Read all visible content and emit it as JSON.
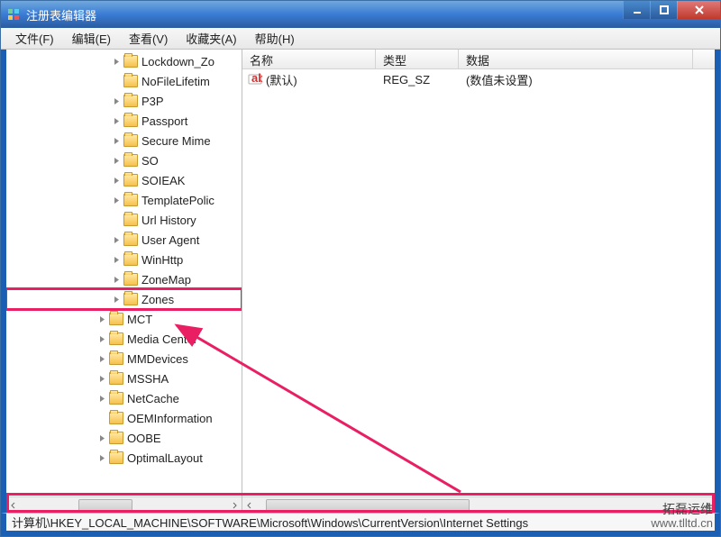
{
  "window": {
    "title": "注册表编辑器"
  },
  "menu": {
    "file": "文件(F)",
    "edit": "编辑(E)",
    "view": "查看(V)",
    "favorites": "收藏夹(A)",
    "help": "帮助(H)"
  },
  "tree": {
    "indent_base": 100,
    "items": [
      {
        "label": "Lockdown_Zo",
        "level": 1,
        "expandable": true
      },
      {
        "label": "NoFileLifetim",
        "level": 1,
        "expandable": false
      },
      {
        "label": "P3P",
        "level": 1,
        "expandable": true
      },
      {
        "label": "Passport",
        "level": 1,
        "expandable": true
      },
      {
        "label": "Secure Mime",
        "level": 1,
        "expandable": true
      },
      {
        "label": "SO",
        "level": 1,
        "expandable": true
      },
      {
        "label": "SOIEAK",
        "level": 1,
        "expandable": true
      },
      {
        "label": "TemplatePolic",
        "level": 1,
        "expandable": true
      },
      {
        "label": "Url History",
        "level": 1,
        "expandable": false
      },
      {
        "label": "User Agent",
        "level": 1,
        "expandable": true
      },
      {
        "label": "WinHttp",
        "level": 1,
        "expandable": true
      },
      {
        "label": "ZoneMap",
        "level": 1,
        "expandable": true
      },
      {
        "label": "Zones",
        "level": 1,
        "expandable": true,
        "highlight": true
      },
      {
        "label": "MCT",
        "level": 0,
        "expandable": true
      },
      {
        "label": "Media Center",
        "level": 0,
        "expandable": true
      },
      {
        "label": "MMDevices",
        "level": 0,
        "expandable": true
      },
      {
        "label": "MSSHA",
        "level": 0,
        "expandable": true
      },
      {
        "label": "NetCache",
        "level": 0,
        "expandable": true
      },
      {
        "label": "OEMInformation",
        "level": 0,
        "expandable": false
      },
      {
        "label": "OOBE",
        "level": 0,
        "expandable": true
      },
      {
        "label": "OptimalLayout",
        "level": 0,
        "expandable": true
      }
    ]
  },
  "list": {
    "headers": {
      "name": "名称",
      "type": "类型",
      "data": "数据"
    },
    "cols": {
      "name_w": 148,
      "type_w": 92,
      "data_w": 260
    },
    "rows": [
      {
        "icon": "string-value-icon",
        "name": "(默认)",
        "type": "REG_SZ",
        "data": "(数值未设置)"
      }
    ]
  },
  "status": {
    "path": "计算机\\HKEY_LOCAL_MACHINE\\SOFTWARE\\Microsoft\\Windows\\CurrentVersion\\Internet Settings"
  },
  "watermark": {
    "line1": "拓磊运维",
    "line2": "www.tlltd.cn"
  }
}
